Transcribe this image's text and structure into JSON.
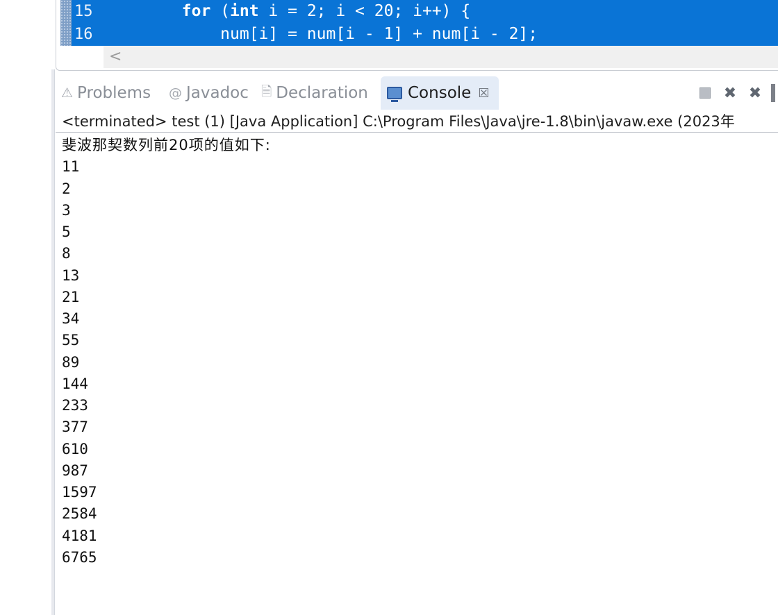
{
  "editor": {
    "lines": [
      {
        "number": "15",
        "indent": "        ",
        "keyword_for": "for",
        "open": " (",
        "keyword_int": "int",
        "rest": " i = 2; i < 20; i++) {"
      },
      {
        "number": "16",
        "text": "            num[i] = num[i - 1] + num[i - 2];"
      }
    ],
    "scroll_left_glyph": "<"
  },
  "tabs": {
    "problems": "Problems",
    "javadoc": "Javadoc",
    "declaration": "Declaration",
    "console": "Console",
    "close_glyph": "☒"
  },
  "toolbar": {
    "remove_glyph": "✖",
    "remove_all_glyph": "✖"
  },
  "console": {
    "status": "<terminated> test (1) [Java Application] C:\\Program Files\\Java\\jre-1.8\\bin\\javaw.exe  (2023年",
    "heading": "斐波那契数列前20项的值如下:",
    "values": [
      "11",
      "2",
      "3",
      "5",
      "8",
      "13",
      "21",
      "34",
      "55",
      "89",
      "144",
      "233",
      "377",
      "610",
      "987",
      "1597",
      "2584",
      "4181",
      "6765"
    ]
  },
  "colors": {
    "selection": "#0a74d6",
    "active_tab": "#e4ecf7"
  }
}
